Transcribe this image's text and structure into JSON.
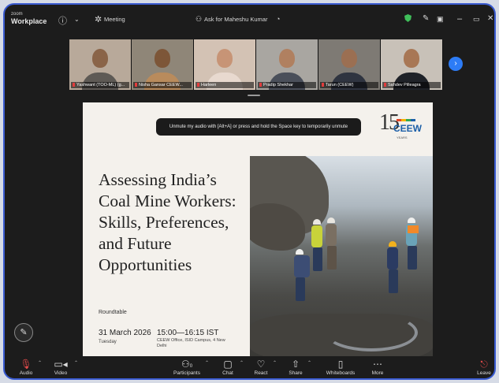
{
  "app": {
    "brand_small": "zoom",
    "brand": "Workplace",
    "meeting_label": "Meeting",
    "participant_count": "",
    "ask_label": "Ask for Maheshu Kumar",
    "header_icons": [
      "info-icon",
      "chevron-down-icon",
      "settings-icon",
      "people-icon",
      "shield-icon",
      "pen-icon",
      "document-icon",
      "minimize-icon",
      "restore-icon",
      "close-icon"
    ]
  },
  "participants": [
    {
      "name": "Yashwant (TOO-ML) (g...",
      "skin": "#8a6448",
      "shirt": "#5e5a55",
      "bg": "#b8a99a"
    },
    {
      "name": "Nisha Gansar CEEW...",
      "skin": "#7d5638",
      "shirt": "#b98b5c",
      "bg": "#8f8678"
    },
    {
      "name": "Harleen",
      "skin": "#c79476",
      "shirt": "#e8d9cf",
      "bg": "#d3c2b4"
    },
    {
      "name": "Pradip Shekhar",
      "skin": "#b08060",
      "shirt": "#4a4f5a",
      "bg": "#a9a6a1"
    },
    {
      "name": "Tarun (CEEW)",
      "skin": "#9b6f52",
      "shirt": "#2f3440",
      "bg": "#7e7a74"
    },
    {
      "name": "Sahdev Pilleagra",
      "skin": "#a87755",
      "shirt": "#1f2228",
      "bg": "#c8c1b8"
    }
  ],
  "next_participants_label": "›",
  "slide": {
    "banner": "Unmute my audio with [Alt+A] or press and hold the Space key to temporarily unmute",
    "logo_number": "15",
    "logo_text": "CEEW",
    "logo_sub": "YEARS",
    "title_lines": [
      "Assessing India’s",
      "Coal Mine Workers:",
      "Skills, Preferences,",
      "and Future",
      "Opportunities"
    ],
    "format": "Roundtable",
    "date": "31 March 2026",
    "day": "Tuesday",
    "time": "15:00—16:15 IST",
    "venue": "CEEW Office, ISID Campus, 4 New Delhi"
  },
  "pen_label": "✎",
  "toolbar": {
    "audio": "Audio",
    "video": "Video",
    "participants": "Participants",
    "participants_count": "0",
    "chat": "Chat",
    "react": "React",
    "share": "Share",
    "whiteboards": "Whiteboards",
    "more": "More",
    "leave": "Leave"
  }
}
